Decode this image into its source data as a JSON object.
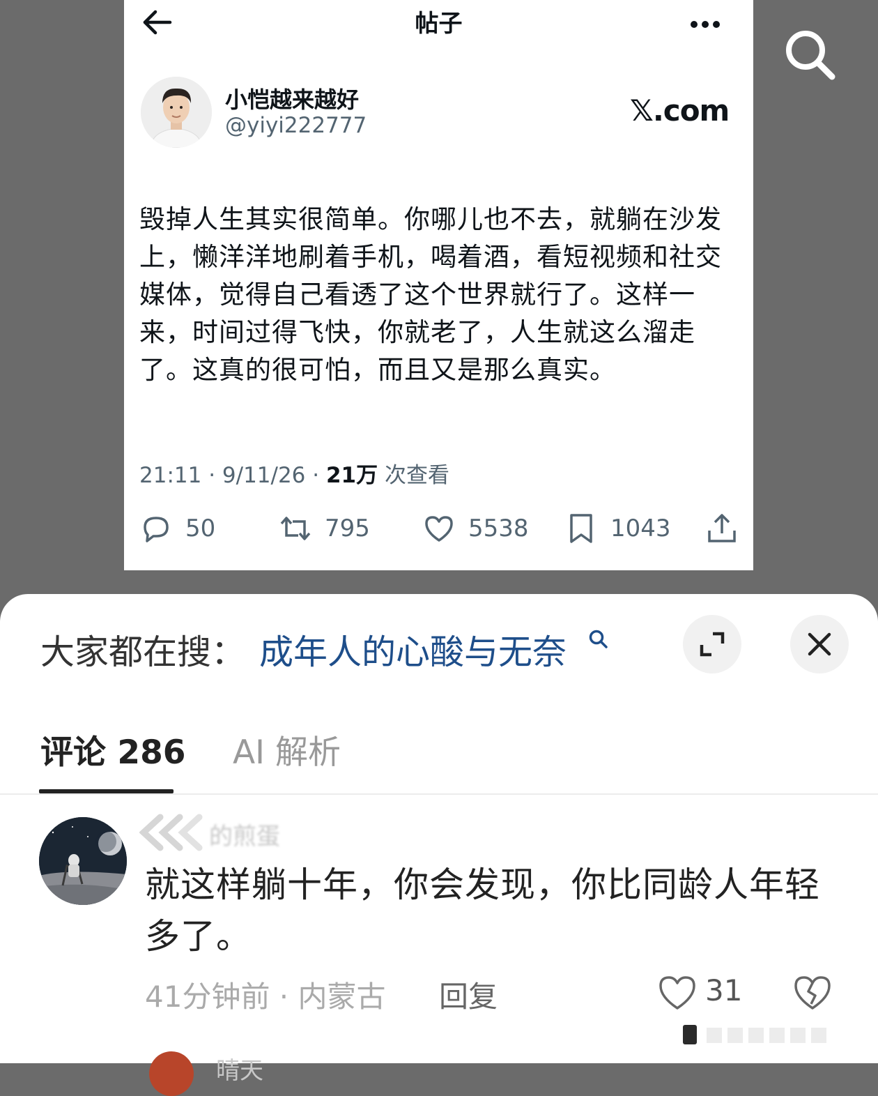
{
  "post": {
    "header_title": "帖子",
    "author_name": "小恺越来越好",
    "author_handle": "@yiyi222777",
    "source": "𝕏.com",
    "body": "毁掉人生其实很简单。你哪儿也不去，就躺在沙发上，懒洋洋地刷着手机，喝着酒，看短视频和社交媒体，觉得自己看透了这个世界就行了。这样一来，时间过得飞快，你就老了，人生就这么溜走了。这真的很可怕，而且又是那么真实。",
    "time_date": "21:11 · 9/11/26 · ",
    "views_count": "21万",
    "views_label": " 次查看",
    "replies": "50",
    "reposts": "795",
    "likes": "5538",
    "bookmarks": "1043"
  },
  "sheet": {
    "hot_search_label": "大家都在搜：",
    "hot_search_term": "成年人的心酸与无奈",
    "tabs": [
      {
        "label": "评论 286",
        "active": true
      },
      {
        "label": "AI 解析",
        "active": false
      }
    ],
    "comment": {
      "user": "的煎蛋",
      "text": "就这样躺十年，你会发现，你比同龄人年轻多了。",
      "meta": "41分钟前 · 内蒙古",
      "reply_label": "回复",
      "likes": "31"
    },
    "next_comment_user": "晴天"
  },
  "colors": {
    "backdrop": "#6b6b6b",
    "link_blue": "#1e4e8a",
    "x_text": "#0f1419",
    "x_gray": "#536471"
  },
  "icons": [
    "search-icon",
    "back-arrow-icon",
    "more-icon",
    "reply-icon",
    "repost-icon",
    "heart-icon",
    "bookmark-icon",
    "share-icon",
    "expand-icon",
    "close-icon",
    "heart-outline-icon",
    "broken-heart-icon"
  ]
}
